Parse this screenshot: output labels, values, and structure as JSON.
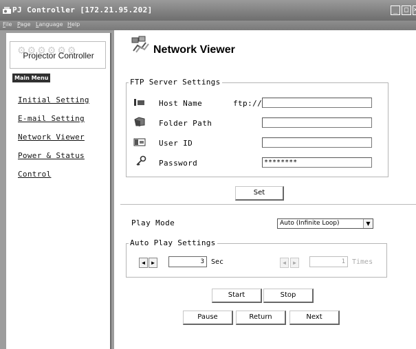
{
  "window": {
    "title": "PJ Controller [172.21.95.202]",
    "minimize_icon": "minimize-icon",
    "maximize_icon": "maximize-icon",
    "close_icon": "close-icon"
  },
  "menubar": {
    "items": [
      {
        "hotkey": "F",
        "rest": "ile"
      },
      {
        "hotkey": "P",
        "rest": "age"
      },
      {
        "hotkey": "L",
        "rest": "anguage"
      },
      {
        "hotkey": "H",
        "rest": "elp"
      }
    ]
  },
  "sidebar": {
    "logo_text": "Projector Controller",
    "section_label": "Main Menu",
    "items": [
      {
        "label": "Initial Setting"
      },
      {
        "label": "E-mail Setting"
      },
      {
        "label": "Network Viewer"
      },
      {
        "label": "Power & Status"
      },
      {
        "label": "Control"
      }
    ]
  },
  "page": {
    "title": "Network Viewer",
    "icon": "network-viewer-icon"
  },
  "ftp": {
    "legend": "FTP Server Settings",
    "host": {
      "label": "Host Name",
      "prefix": "ftp://",
      "value": "",
      "icon": "host-icon"
    },
    "folder": {
      "label": "Folder Path",
      "value": "",
      "icon": "folder-icon"
    },
    "user": {
      "label": "User ID",
      "value": "",
      "icon": "user-id-icon"
    },
    "password": {
      "label": "Password",
      "value": "********",
      "icon": "key-icon"
    },
    "set_label": "Set"
  },
  "play": {
    "mode_label": "Play Mode",
    "mode_value": "Auto (Infinite Loop)",
    "auto_legend": "Auto Play Settings",
    "interval_value": "3",
    "interval_unit": "Sec",
    "times_value": "1",
    "times_unit": "Times"
  },
  "controls": {
    "start": "Start",
    "stop": "Stop",
    "pause": "Pause",
    "return": "Return",
    "next": "Next"
  },
  "colors": {
    "titlebar": "#7e7e7e",
    "sidebar_frame": "#9d9d9d",
    "badge": "#303030"
  }
}
